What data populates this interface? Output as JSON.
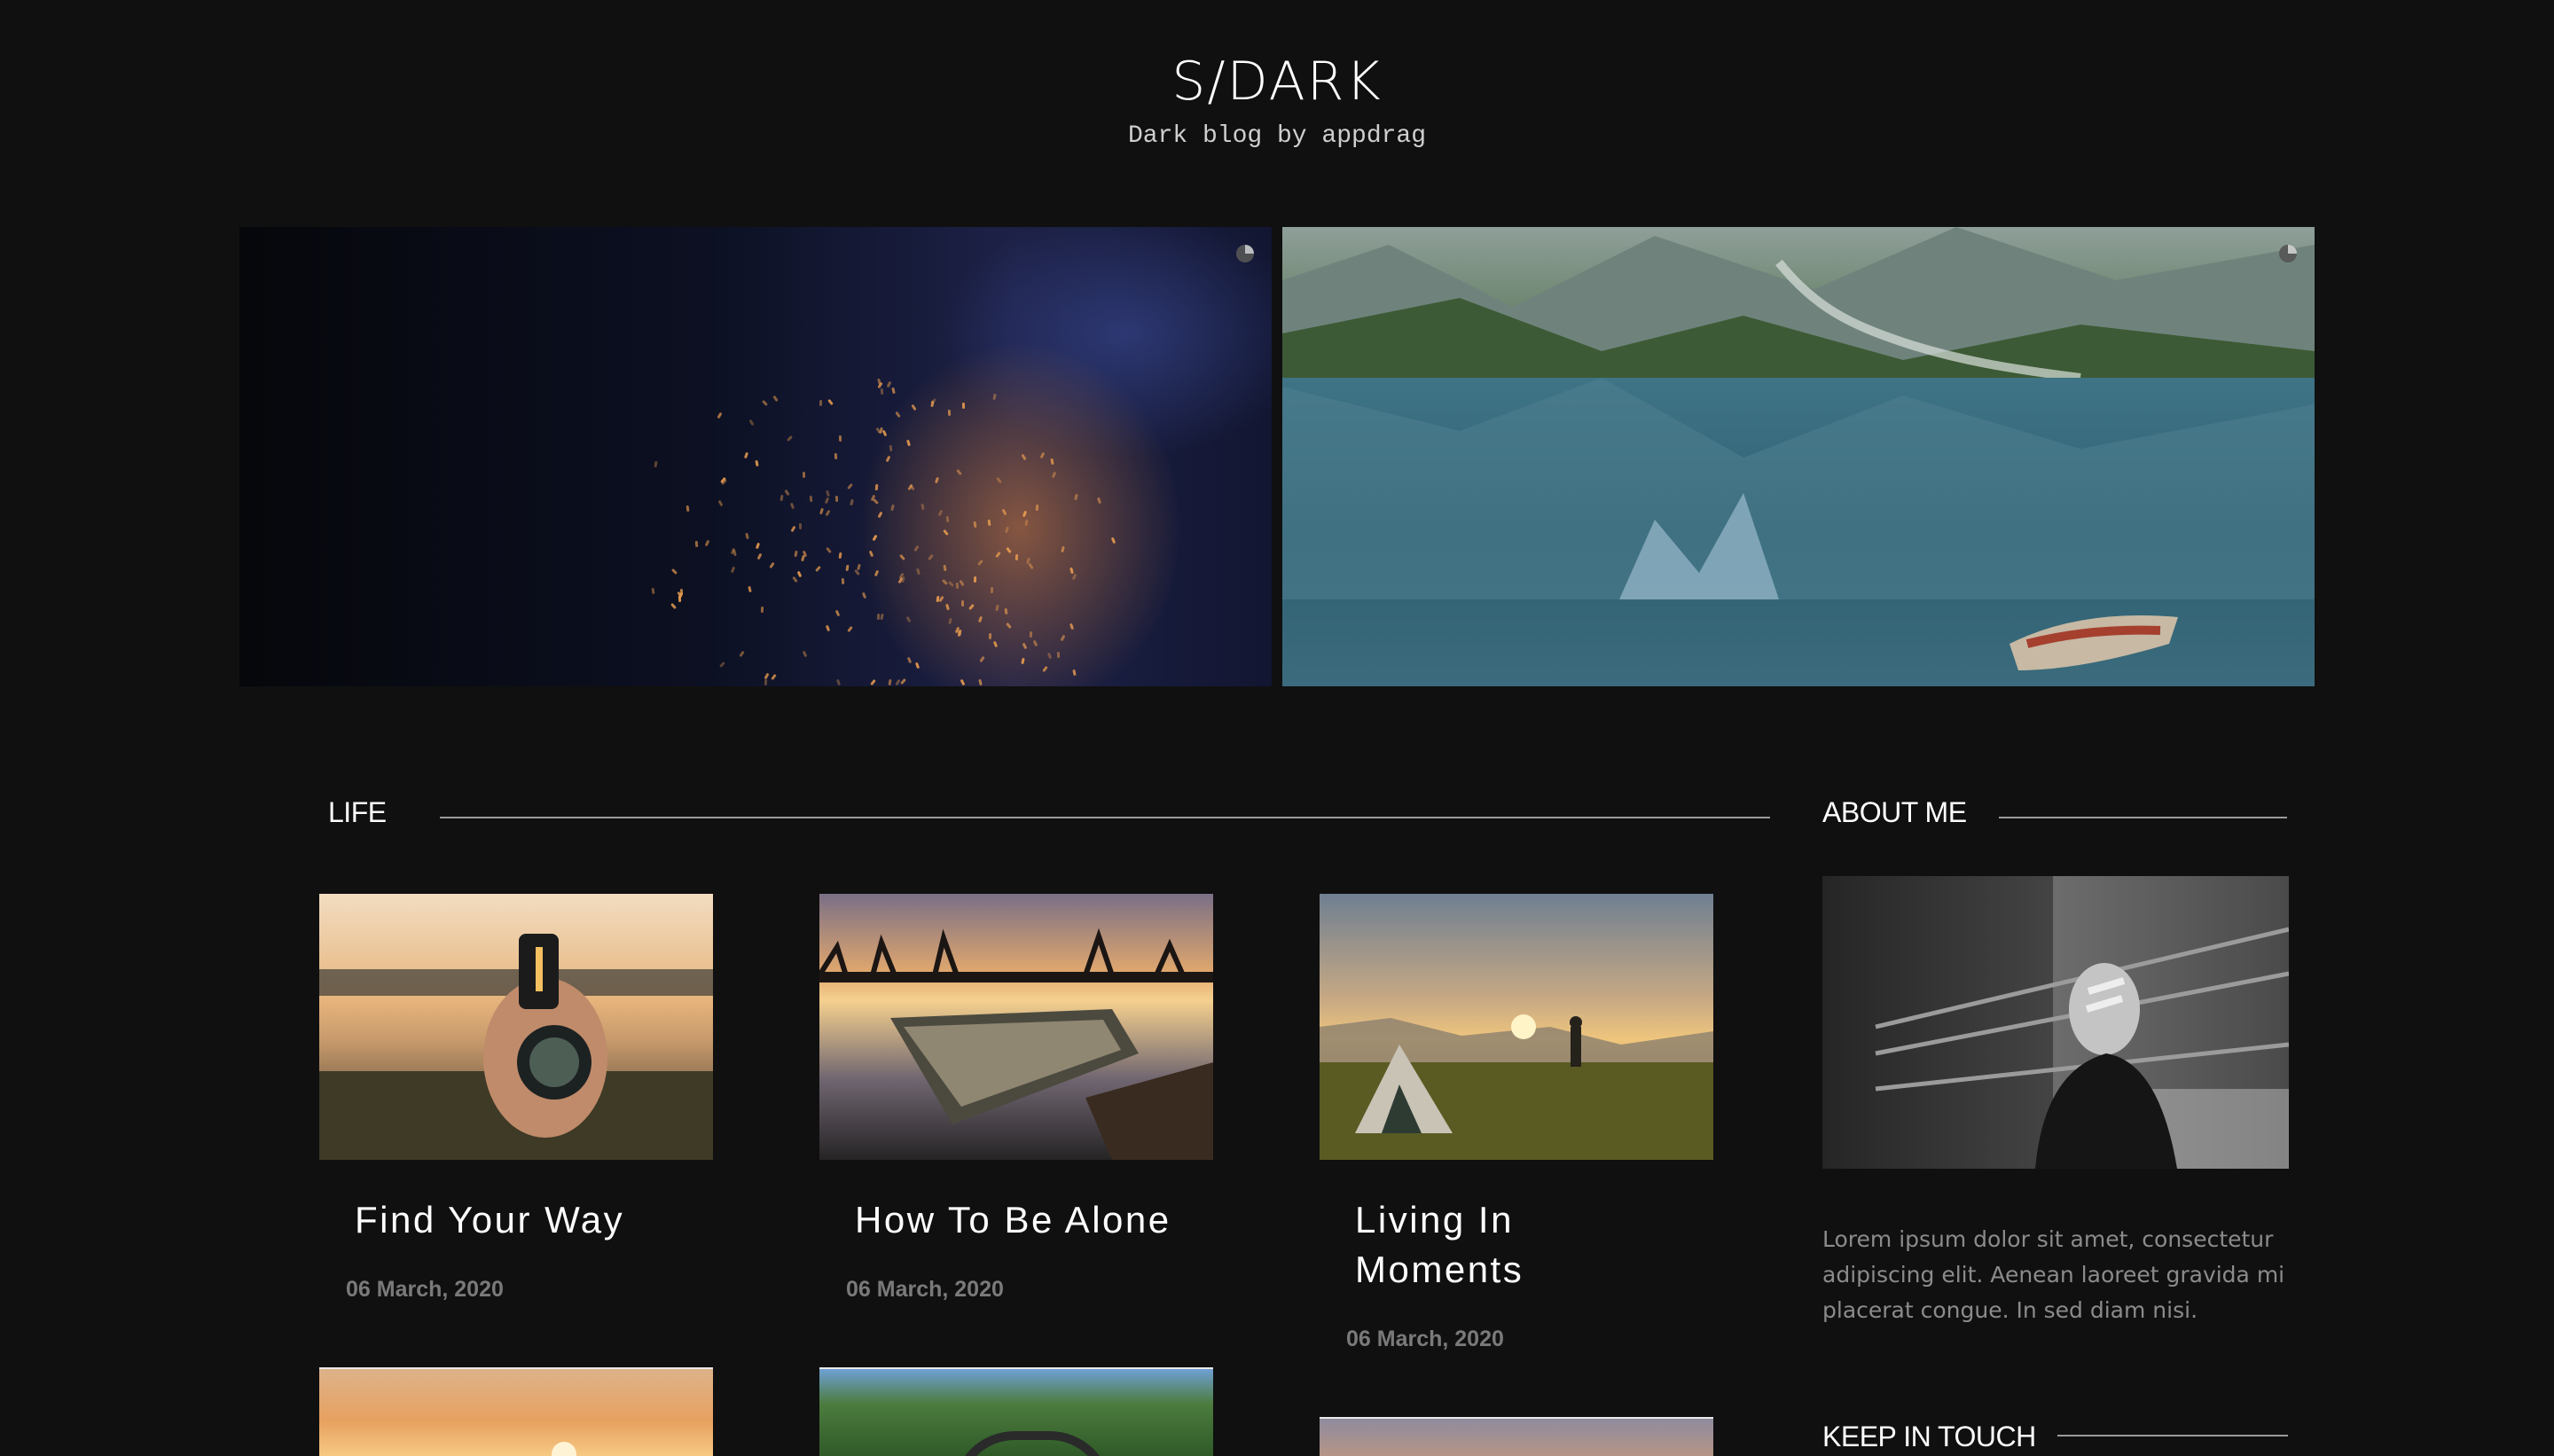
{
  "header": {
    "title": "S/DARK",
    "tagline": "Dark blog by appdrag"
  },
  "hero": {
    "slides": [
      {
        "scene": "campfire sparks at night"
      },
      {
        "scene": "mountain lake with rowing boat"
      }
    ],
    "icons": [
      "loading-spinner-icon",
      "loading-spinner-icon"
    ]
  },
  "life_section": {
    "heading": "LIFE",
    "posts": [
      {
        "title": "Find Your Way",
        "date": "06 March, 2020"
      },
      {
        "title": "How To Be Alone",
        "date": "06 March, 2020"
      },
      {
        "title": "Living In Moments",
        "title_line1": "Living In",
        "title_line2": "Moments",
        "date": "06 March, 2020"
      }
    ]
  },
  "sidebar": {
    "about_heading": "ABOUT ME",
    "about_text": "Lorem ipsum dolor sit amet, consectetur adipiscing elit. Aenean laoreet gravida mi placerat congue. In sed diam nisi.",
    "keep_in_touch_heading": "KEEP IN TOUCH"
  },
  "colors": {
    "background": "#101010",
    "text": "#ffffff",
    "muted": "#7a7a7a",
    "rule": "#9a9a9a"
  }
}
